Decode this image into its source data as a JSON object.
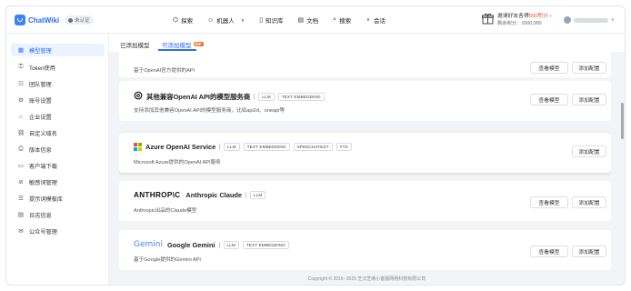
{
  "app": {
    "name": "ChatWiki",
    "version_badge": "未认证"
  },
  "nav": [
    {
      "icon": "⌬",
      "icon_name": "explore-icon",
      "label": "探索"
    },
    {
      "icon": "☺",
      "icon_name": "robot-icon",
      "label": "机器人",
      "dropdown": true
    },
    {
      "icon": "▯",
      "icon_name": "book-icon",
      "label": "知识库"
    },
    {
      "icon": "▤",
      "icon_name": "document-icon",
      "label": "文档"
    },
    {
      "icon": "⌕",
      "icon_name": "search-icon",
      "label": "搜索"
    },
    {
      "icon": "⚬",
      "icon_name": "chat-icon",
      "label": "会话"
    }
  ],
  "invite": {
    "text_prefix": "邀请好友各得",
    "highlight": "500积分",
    "text_suffix": " ›",
    "balance": "剩余积分：1000.000"
  },
  "sidebar": {
    "items": [
      {
        "icon": "▦",
        "icon_name": "model-icon",
        "label": "模型管理",
        "active": true
      },
      {
        "icon": "⚿",
        "icon_name": "token-icon",
        "label": "Token使用"
      },
      {
        "icon": "☷",
        "icon_name": "team-icon",
        "label": "团队管理"
      },
      {
        "icon": "⚙",
        "icon_name": "account-settings-icon",
        "label": "账号设置"
      },
      {
        "icon": "⌂",
        "icon_name": "enterprise-icon",
        "label": "企业设置"
      },
      {
        "icon": "⛓",
        "icon_name": "domain-icon",
        "label": "自定义域名"
      },
      {
        "icon": "⎙",
        "icon_name": "version-icon",
        "label": "版本信息"
      },
      {
        "icon": "▭",
        "icon_name": "download-icon",
        "label": "客户端下载"
      },
      {
        "icon": "⊘",
        "icon_name": "sensitive-words-icon",
        "label": "敏感词管理"
      },
      {
        "icon": "☰",
        "icon_name": "prompt-template-icon",
        "label": "提示词模板库"
      },
      {
        "icon": "▤",
        "icon_name": "log-icon",
        "label": "日志信息"
      },
      {
        "icon": "✉",
        "icon_name": "wechat-official-icon",
        "label": "公众号管理"
      }
    ]
  },
  "tabs": [
    {
      "label": "已添加模型",
      "active": false
    },
    {
      "label": "可添加模型",
      "active": true,
      "badge": "VIP"
    }
  ],
  "cards": [
    {
      "title": "",
      "desc": "基于OpenAI官方提供的API",
      "tags": [],
      "buttons": [
        "查看模型",
        "添加配置"
      ]
    },
    {
      "title": "其他兼容OpenAI API的模型服务商",
      "desc": "支持添加其他兼容OpenAI API的模型服务商，比如api2d、oneapi等",
      "tags": [
        "LLM",
        "TEXT EMBEDDING"
      ],
      "buttons": [
        "查看模型",
        "添加配置"
      ]
    },
    {
      "title": "Azure OpenAI Service",
      "desc": "Microsoft Azure提供的OpenAI API服务",
      "tags": [
        "LLM",
        "TEXT EMBEDDING",
        "SPEECH2TEXT",
        "TTS"
      ],
      "buttons": [
        "添加配置"
      ]
    },
    {
      "brand_text": "ANTHROP\\C",
      "title": "Anthropic Claude",
      "desc": "Anthropic出品的Claude模型",
      "tags": [
        "LLM"
      ],
      "buttons": [
        "查看模型",
        "添加配置"
      ]
    },
    {
      "brand_text": "Gemini",
      "title": "Google Gemini",
      "desc": "基于Google提供的Gemini API",
      "tags": [
        "LLM",
        "TEXT EMBEDDING"
      ],
      "buttons": [
        "查看模型",
        "添加配置"
      ]
    }
  ],
  "footer": "Copyright © 2016- 2025 芝汉芝麻小客服网络科技有限公司",
  "colors": {
    "accent": "#2b6cf6",
    "highlight_red": "#e0522a",
    "background": "#f3f4f7"
  }
}
